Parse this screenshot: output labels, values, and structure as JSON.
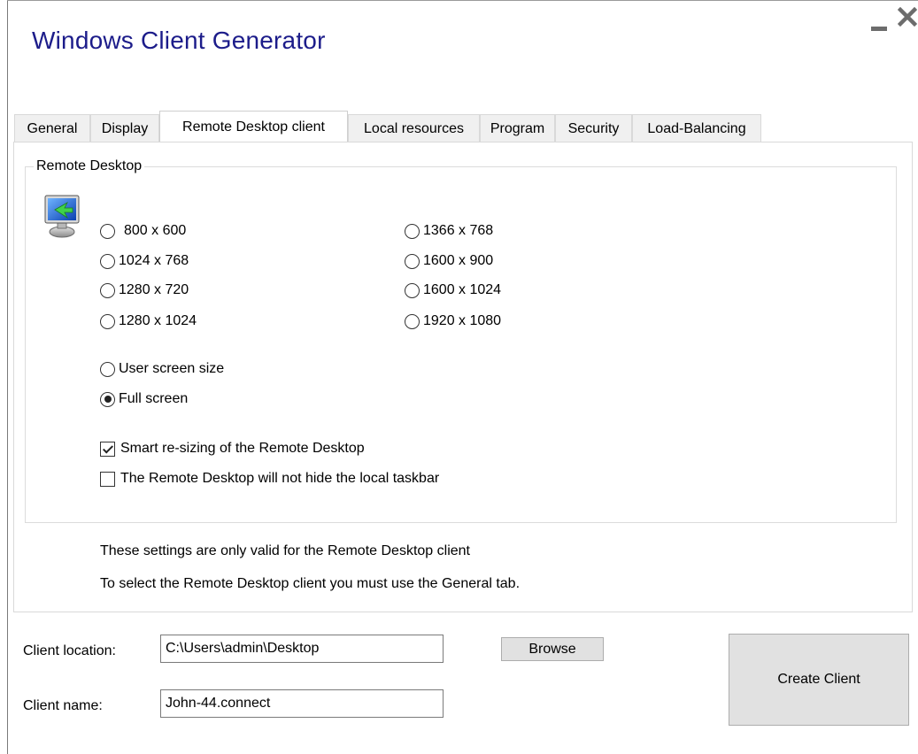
{
  "app": {
    "title": "Windows Client Generator"
  },
  "tabs": [
    {
      "label": "General",
      "active": false
    },
    {
      "label": "Display",
      "active": false
    },
    {
      "label": "Remote Desktop client",
      "active": true
    },
    {
      "label": "Local resources",
      "active": false
    },
    {
      "label": "Program",
      "active": false
    },
    {
      "label": "Security",
      "active": false
    },
    {
      "label": "Load-Balancing",
      "active": false
    }
  ],
  "remote_desktop": {
    "group_label": "Remote Desktop",
    "icon": "remote-desktop-monitor-icon",
    "resolutions_left": [
      {
        "label": "800 x 600",
        "checked": false
      },
      {
        "label": "1024 x 768",
        "checked": false
      },
      {
        "label": "1280 x 720",
        "checked": false
      },
      {
        "label": "1280 x 1024",
        "checked": false
      }
    ],
    "resolutions_right": [
      {
        "label": "1366 x 768",
        "checked": false
      },
      {
        "label": "1600 x 900",
        "checked": false
      },
      {
        "label": "1600 x 1024",
        "checked": false
      },
      {
        "label": "1920 x 1080",
        "checked": false
      }
    ],
    "user_screen_size": {
      "label": "User screen size",
      "checked": false
    },
    "full_screen": {
      "label": "Full screen",
      "checked": true
    },
    "smart_resizing": {
      "label": "Smart re-sizing of the Remote Desktop",
      "checked": true
    },
    "no_hide_taskbar": {
      "label": "The Remote Desktop will not hide the local taskbar",
      "checked": false
    }
  },
  "notes": {
    "line1": "These settings are only valid for the Remote Desktop client",
    "line2": "To select the Remote Desktop client you must use the General tab."
  },
  "footer": {
    "client_location_label": "Client location:",
    "client_location_value": "C:\\Users\\admin\\Desktop",
    "browse_label": "Browse",
    "client_name_label": "Client name:",
    "client_name_value": "John-44.connect",
    "create_client_label": "Create Client"
  }
}
